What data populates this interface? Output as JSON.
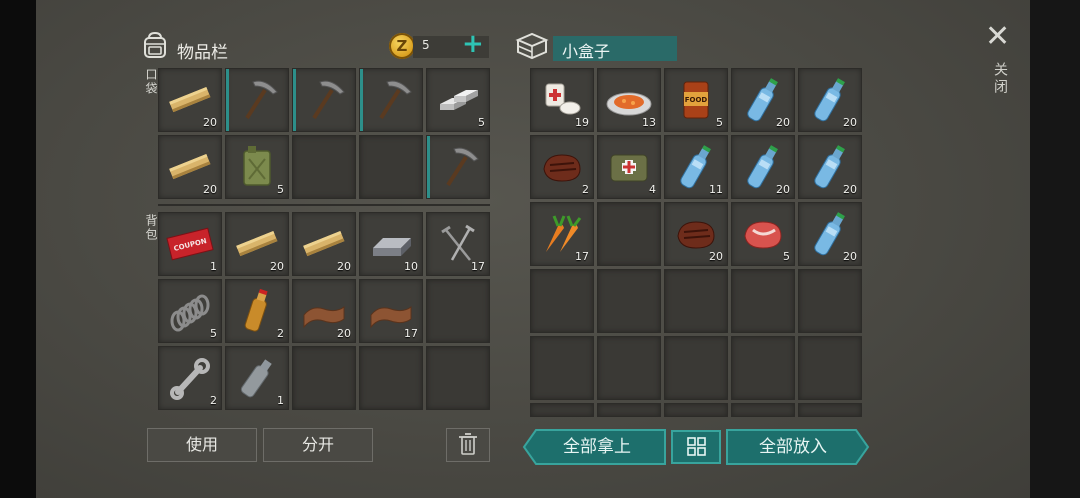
{
  "inventory": {
    "title": "物品栏",
    "coins": "5",
    "coin_symbol": "Z",
    "pockets_label": "口袋",
    "backpack_label": "背包",
    "pockets": [
      {
        "item": "wooden-plank",
        "qty": "20",
        "equipped": false
      },
      {
        "item": "pickaxe",
        "qty": "",
        "equipped": true
      },
      {
        "item": "pickaxe",
        "qty": "",
        "equipped": true
      },
      {
        "item": "pickaxe",
        "qty": "",
        "equipped": true
      },
      {
        "item": "iron-ingots",
        "qty": "5",
        "equipped": false
      },
      {
        "item": "wooden-plank",
        "qty": "20",
        "equipped": false
      },
      {
        "item": "jerrycan",
        "qty": "5",
        "equipped": false
      },
      {
        "item": "empty",
        "qty": "",
        "equipped": false
      },
      {
        "item": "empty",
        "qty": "",
        "equipped": false
      },
      {
        "item": "pickaxe",
        "qty": "",
        "equipped": true
      }
    ],
    "backpack": [
      {
        "item": "coupon",
        "qty": "1",
        "coupon_text": "COUPON"
      },
      {
        "item": "wooden-plank",
        "qty": "20"
      },
      {
        "item": "wooden-plank",
        "qty": "20"
      },
      {
        "item": "metal-bar",
        "qty": "10"
      },
      {
        "item": "nails",
        "qty": "17"
      },
      {
        "item": "spring",
        "qty": "5"
      },
      {
        "item": "bottle-oil",
        "qty": "2"
      },
      {
        "item": "leather",
        "qty": "20"
      },
      {
        "item": "leather",
        "qty": "17"
      },
      {
        "item": "empty",
        "qty": ""
      },
      {
        "item": "wrench",
        "qty": "2"
      },
      {
        "item": "empty-bottle",
        "qty": "1"
      },
      {
        "item": "empty",
        "qty": ""
      },
      {
        "item": "empty",
        "qty": ""
      },
      {
        "item": "empty",
        "qty": ""
      }
    ],
    "use_label": "使用",
    "split_label": "分开"
  },
  "container": {
    "title": "小盒子",
    "slots": [
      {
        "item": "bandage-pills",
        "qty": "19"
      },
      {
        "item": "cooked-dish",
        "qty": "13"
      },
      {
        "item": "canned-food",
        "qty": "5",
        "can_text": "FOOD"
      },
      {
        "item": "water-bottle",
        "qty": "20"
      },
      {
        "item": "water-bottle",
        "qty": "20"
      },
      {
        "item": "cooked-steak",
        "qty": "2"
      },
      {
        "item": "first-aid-bag",
        "qty": "4"
      },
      {
        "item": "water-bottle",
        "qty": "11"
      },
      {
        "item": "water-bottle",
        "qty": "20"
      },
      {
        "item": "water-bottle",
        "qty": "20"
      },
      {
        "item": "carrots",
        "qty": "17"
      },
      {
        "item": "empty",
        "qty": ""
      },
      {
        "item": "cooked-steak",
        "qty": "20"
      },
      {
        "item": "raw-steak",
        "qty": "5"
      },
      {
        "item": "water-bottle",
        "qty": "20"
      },
      {
        "item": "empty",
        "qty": ""
      },
      {
        "item": "empty",
        "qty": ""
      },
      {
        "item": "empty",
        "qty": ""
      },
      {
        "item": "empty",
        "qty": ""
      },
      {
        "item": "empty",
        "qty": ""
      },
      {
        "item": "empty",
        "qty": ""
      },
      {
        "item": "empty",
        "qty": ""
      },
      {
        "item": "empty",
        "qty": ""
      },
      {
        "item": "empty",
        "qty": ""
      },
      {
        "item": "empty",
        "qty": ""
      },
      {
        "item": "empty",
        "qty": ""
      },
      {
        "item": "empty",
        "qty": ""
      },
      {
        "item": "empty",
        "qty": ""
      },
      {
        "item": "empty",
        "qty": ""
      },
      {
        "item": "empty",
        "qty": ""
      }
    ],
    "take_all_label": "全部拿上",
    "put_all_label": "全部放入"
  },
  "close_label": "关闭",
  "colors": {
    "accent": "#1d6f6c",
    "accent_light": "#2ec4b4",
    "equipped_bar": "#2d8f8a"
  }
}
